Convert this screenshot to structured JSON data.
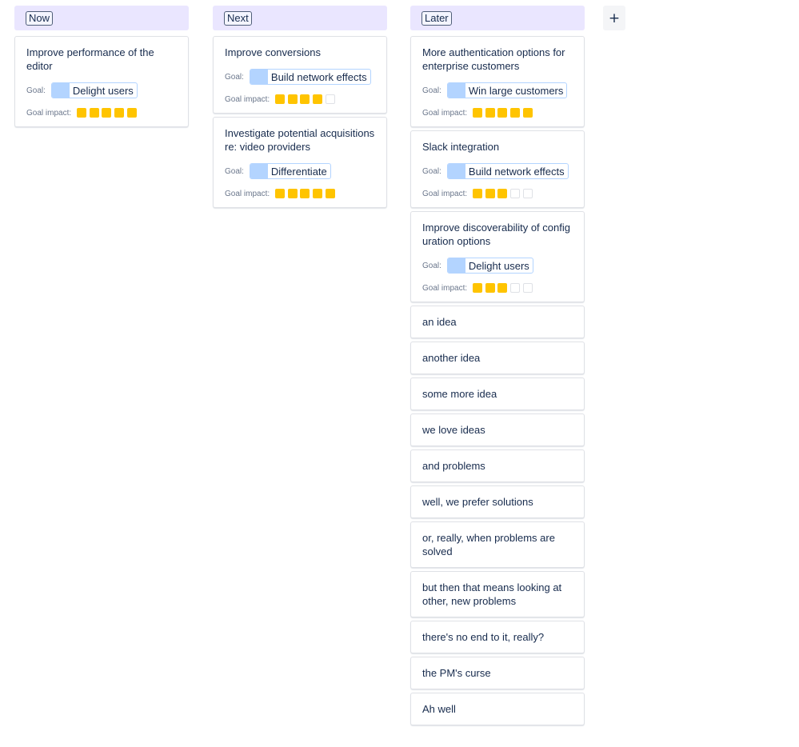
{
  "colors": {
    "header_bg": "#eae6ff",
    "goal_swatch": "#b3d4ff",
    "impact_filled": "#ffc400",
    "impact_empty": "#dfe1e6"
  },
  "labels": {
    "goal": "Goal:",
    "goal_impact": "Goal impact:"
  },
  "add_column": {
    "label": "+",
    "icon": "plus-icon"
  },
  "columns": [
    {
      "title": "Now",
      "cards": [
        {
          "title": "Improve performance of the editor",
          "goal": "Delight users",
          "impact": 5
        }
      ]
    },
    {
      "title": "Next",
      "cards": [
        {
          "title": "Improve conversions",
          "goal": "Build network effects",
          "impact": 4
        },
        {
          "title": "Investigate potential acquisitions re: video providers",
          "goal": "Differentiate",
          "impact": 5
        }
      ]
    },
    {
      "title": "Later",
      "cards": [
        {
          "title": "More authentication options for enterprise customers",
          "goal": "Win large customers",
          "impact": 5
        },
        {
          "title": "Slack integration",
          "goal": "Build network effects",
          "impact": 3
        },
        {
          "title": "Improve discoverability of config uration options",
          "goal": "Delight users",
          "impact": 3
        },
        {
          "title": "an idea"
        },
        {
          "title": "another idea"
        },
        {
          "title": "some more idea"
        },
        {
          "title": "we love ideas"
        },
        {
          "title": "and problems"
        },
        {
          "title": "well, we prefer solutions"
        },
        {
          "title": "or, really, when problems are solved"
        },
        {
          "title": "but then that means looking at other, new problems"
        },
        {
          "title": "there's no end to it, really?"
        },
        {
          "title": "the PM's curse"
        },
        {
          "title": "Ah well"
        }
      ]
    }
  ]
}
